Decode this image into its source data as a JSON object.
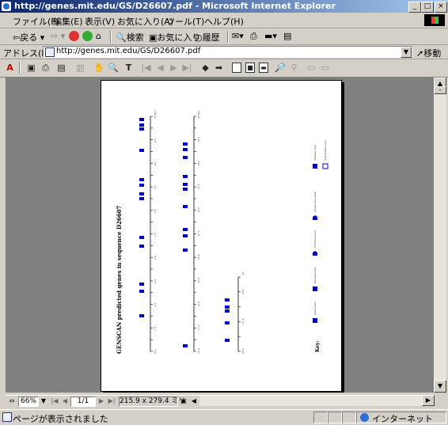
{
  "window": {
    "title": "http://genes.mit.edu/GS/D26607.pdf - Microsoft Internet Explorer",
    "min": "_",
    "max": "□",
    "close": "×"
  },
  "menu": [
    "ファイル(F)",
    "編集(E)",
    "表示(V)",
    "お気に入り(A)",
    "ツール(T)",
    "ヘルプ(H)"
  ],
  "nav": {
    "back": "戻る",
    "search": "検索",
    "favorites": "お気に入り",
    "history": "履歴"
  },
  "address": {
    "label": "アドレス(D)",
    "url": "http://genes.mit.edu/GS/D26607.pdf",
    "go": "移動"
  },
  "pdf": {
    "title": "GENSCAN predicted genes in sequence D26607",
    "key_label": "Key:",
    "legend": [
      {
        "label": "Initial exon"
      },
      {
        "label": "Internal exon"
      },
      {
        "label": "Terminal exon"
      },
      {
        "label": "Single-exon gene"
      },
      {
        "label": "Optimal exon"
      },
      {
        "label": "Suboptimal exon"
      }
    ],
    "axis_unit": "kb",
    "axes": [
      {
        "ticks": [
          "0.0",
          "0.5",
          "1.0",
          "1.5",
          "2.0",
          "2.5",
          "3.0",
          "3.5",
          "4.0",
          "4.5",
          "5.0",
          "5.5",
          "6.0",
          "6.5",
          "7.0",
          "7.5",
          "8.0",
          "8.5",
          "9.0",
          "9.5",
          "10.0"
        ]
      },
      {
        "ticks": [
          "10.0",
          "10.5",
          "11.0",
          "11.5",
          "12.0",
          "12.5",
          "13.0",
          "13.5",
          "14.0",
          "14.5",
          "15.0",
          "15.5",
          "16.0",
          "16.5",
          "17.0",
          "17.5",
          "18.0",
          "18.5",
          "19.0",
          "19.5",
          "20.0"
        ]
      },
      {
        "ticks": [
          "20.0",
          "20.5",
          "21.0",
          "21.5",
          "22.0",
          "22.5"
        ]
      }
    ]
  },
  "pdfbottom": {
    "zoom": "66%",
    "page": "1/1",
    "size": "215.9 x 279.4 ミリ"
  },
  "status": {
    "text": "ページが表示されました",
    "zone": "インターネット"
  },
  "colors": {
    "exon": "#0000cc",
    "titlebar": "#0a246a"
  }
}
